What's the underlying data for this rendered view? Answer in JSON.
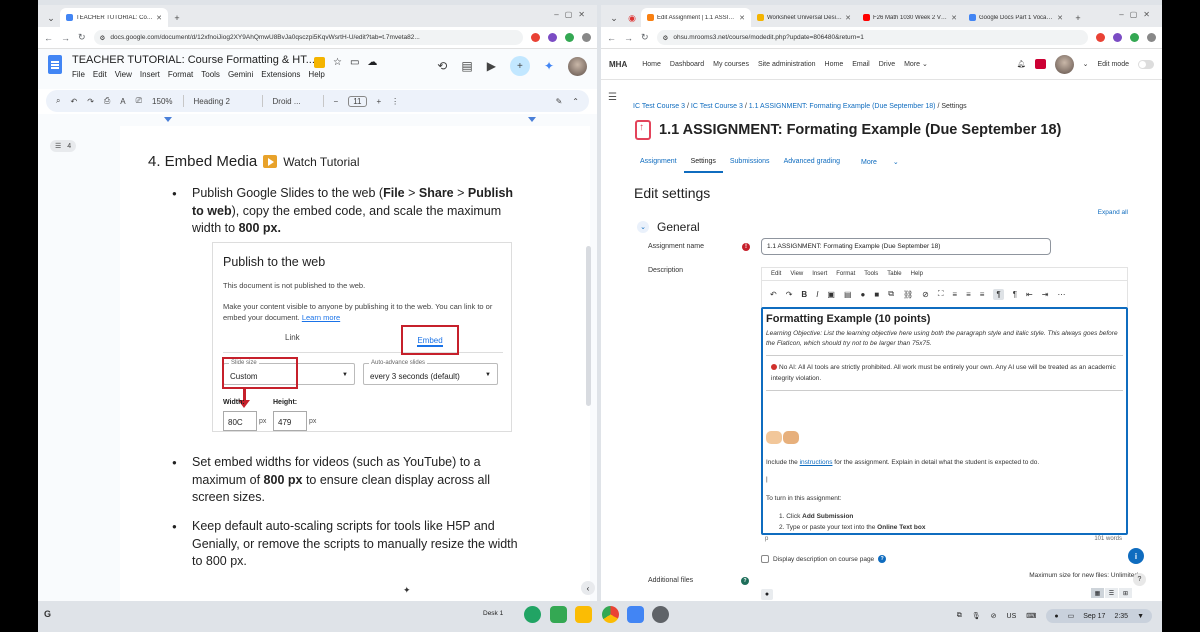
{
  "left": {
    "tab_title": "TEACHER TUTORIAL: Course F",
    "url": "docs.google.com/document/d/12xfnoiJiog2XY9AhQmwU8BvJa0qsczpi5KqvWsrtH-U/edit?tab=t.7mveta82...",
    "doc_title": "TEACHER TUTORIAL: Course Formatting & HT...",
    "menu": [
      "File",
      "Edit",
      "View",
      "Insert",
      "Format",
      "Tools",
      "Gemini",
      "Extensions",
      "Help"
    ],
    "toolbar": {
      "zoom": "150%",
      "style": "Heading 2",
      "font": "Droid ...",
      "size": "11"
    },
    "outline_count": "4",
    "heading": "4.  Embed Media",
    "watch": "Watch Tutorial",
    "b1_a": "Publish Google Slides to the web (",
    "b1_file": "File",
    "b1_gt1": " > ",
    "b1_share": "Share",
    "b1_gt2": " > ",
    "b1_publish": "Publish to web",
    "b1_b": "), copy the embed code, and scale the maximum width to ",
    "b1_800": "800 px.",
    "embed": {
      "title": "Publish to the web",
      "not_published": "This document is not published to the web.",
      "desc": "Make your content visible to anyone by publishing it to the web. You can link to or embed your document.",
      "learn": "Learn more",
      "tab_link": "Link",
      "tab_embed": "Embed",
      "slide_size_label": "Slide size",
      "slide_size_value": "Custom",
      "auto_label": "Auto-advance slides",
      "auto_value": "every 3 seconds (default)",
      "width_label": "Width:",
      "height_label": "Height:",
      "width_value": "80C",
      "height_value": "479",
      "px1": "px",
      "px2": "px"
    },
    "b2_a": "Set embed widths for videos (such as YouTube) to a maximum of ",
    "b2_800": "800 px",
    "b2_b": " to ensure clean display across all screen sizes.",
    "b3": "Keep default auto-scaling scripts for tools like H5P and Genially, or remove the scripts to manually resize the width to 800 px."
  },
  "right": {
    "tabs": [
      "Edit Assignment | 1.1 ASSIGN",
      "Worksheet Universal Design F",
      "F26 Math 1030 Week 2 Video",
      "Google Docs Part 1 Vocabular"
    ],
    "url": "ohsu.mrooms3.net/course/modedit.php?update=806480&return=1",
    "brand": "MHA",
    "nav": [
      "Home",
      "Dashboard",
      "My courses",
      "Site administration",
      "Home",
      "Email",
      "Drive",
      "More"
    ],
    "edit_mode": "Edit mode",
    "crumbs": [
      "IC Test Course 3",
      "IC Test Course 3",
      "1.1 ASSIGNMENT: Formating Example (Due September 18)",
      "Settings"
    ],
    "crumb_sep": "/",
    "title": "1.1 ASSIGNMENT: Formating Example (Due September 18)",
    "sec_tabs": [
      "Assignment",
      "Settings",
      "Submissions",
      "Advanced grading",
      "More"
    ],
    "edit_settings": "Edit settings",
    "expand_all": "Expand all",
    "general": "General",
    "name_label": "Assignment name",
    "name_value": "1.1 ASSIGNMENT: Formating Example (Due September 18)",
    "desc_label": "Description",
    "ed_menu": [
      "Edit",
      "View",
      "Insert",
      "Format",
      "Tools",
      "Table",
      "Help"
    ],
    "ed_heading": "Formatting Example (10 points)",
    "ed_lo": "Learning Objective: List the learning objective here using both the paragraph style and italic style. This always goes before the FlatIcon, which should try not to be larger than 75x75.",
    "ed_ai": "No AI: All AI tools are strictly prohibited. All work must be entirely your own. Any AI use will be treated as an academic integrity violation.",
    "ed_p1_a": "Include the ",
    "ed_p1_link": "instructions",
    "ed_p1_b": " for the assignment. Explain in detail what the student is expected to do.",
    "ed_p2": "To turn in this assignment:",
    "ed_li1_a": "Click ",
    "ed_li1_b": "Add Submission",
    "ed_li2_a": "Type or paste your text into the ",
    "ed_li2_b": "Online Text box",
    "ed_p_tag": "p",
    "words": "101 words",
    "display_desc": "Display description on course page",
    "files_label": "Additional files",
    "max_size": "Maximum size for new files: Unlimited"
  },
  "shelf": {
    "desk": "Desk 1",
    "locale": "US",
    "date": "Sep 17",
    "time": "2:35"
  }
}
